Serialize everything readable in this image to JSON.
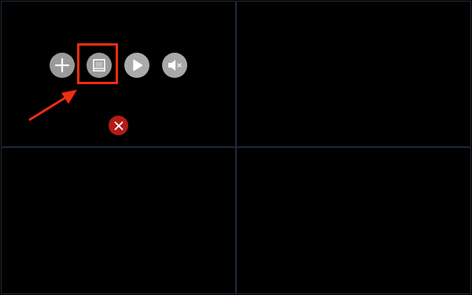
{
  "toolbar": {
    "buttons": [
      {
        "name": "add",
        "icon": "plus-icon"
      },
      {
        "name": "layout",
        "icon": "layout-icon"
      },
      {
        "name": "play",
        "icon": "play-icon"
      },
      {
        "name": "mute",
        "icon": "speaker-muted-icon"
      }
    ],
    "close_icon": "close-icon"
  },
  "annotation": {
    "highlight_color": "#f22c12",
    "highlight_target": "layout-button"
  },
  "colors": {
    "background": "#000000",
    "grid_line": "#1d2a38",
    "button_gray": "#9a9a9a",
    "close_red": "#b31b16"
  }
}
